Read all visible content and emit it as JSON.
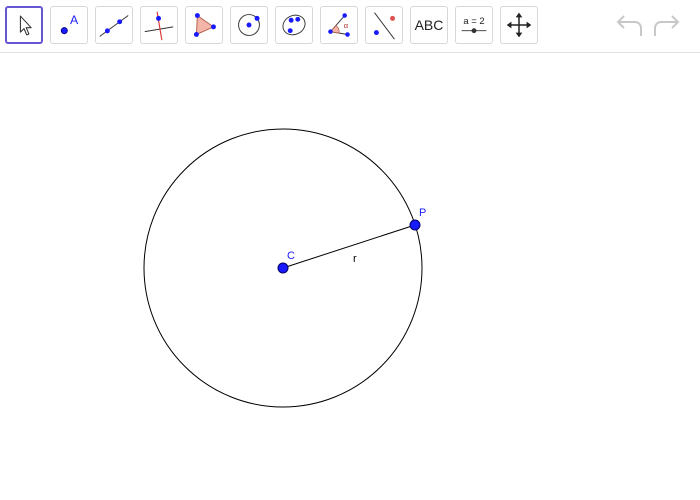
{
  "toolbar": {
    "tools": [
      {
        "name": "move",
        "icon": "arrow-pointer-icon",
        "selected": true
      },
      {
        "name": "point",
        "icon": "point-icon",
        "label": "A"
      },
      {
        "name": "line",
        "icon": "line-through-two-points-icon"
      },
      {
        "name": "perpendicular",
        "icon": "perpendicular-line-icon"
      },
      {
        "name": "polygon",
        "icon": "polygon-icon"
      },
      {
        "name": "circle-center-point",
        "icon": "circle-with-center-icon"
      },
      {
        "name": "ellipse",
        "icon": "ellipse-icon"
      },
      {
        "name": "angle",
        "icon": "angle-icon",
        "label": "α"
      },
      {
        "name": "reflect",
        "icon": "reflect-about-line-icon"
      },
      {
        "name": "text",
        "icon": "text-icon",
        "label": "ABC"
      },
      {
        "name": "slider",
        "icon": "slider-icon",
        "label": "a = 2"
      },
      {
        "name": "move-graphics-view",
        "icon": "move-graphics-view-icon"
      }
    ],
    "undo_icon": "undo-icon",
    "redo_icon": "redo-icon"
  },
  "construction": {
    "center_label": "C",
    "point_label": "P",
    "radius_label": "r"
  },
  "colors": {
    "point": "#1a1aff",
    "point_stroke": "#000066",
    "label": "#1a1aff",
    "circle": "#000000",
    "selection": "#6557d2",
    "reflection_dot": "#e05050"
  }
}
